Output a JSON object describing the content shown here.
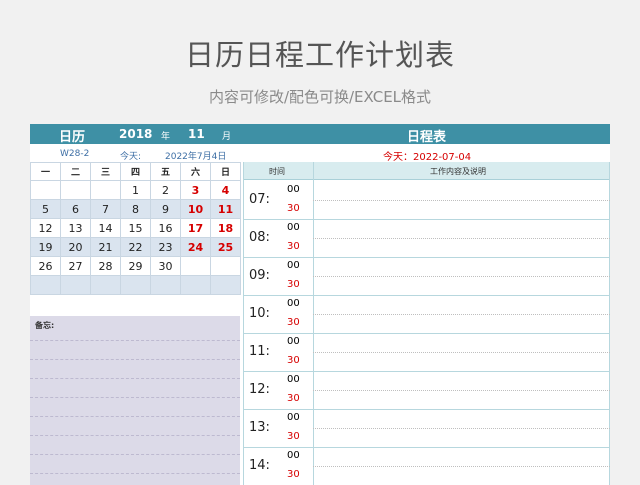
{
  "page": {
    "title": "日历日程工作计划表",
    "subtitle": "内容可修改/配色可换/EXCEL格式"
  },
  "header": {
    "calendar_label": "日历",
    "year": "2018",
    "year_unit": "年",
    "month": "11",
    "month_unit": "月",
    "schedule_label": "日程表"
  },
  "info": {
    "week": "W28-2",
    "today_label": "今天:",
    "today_date": "2022年7月4日",
    "today_iso": "今天：2022-07-04"
  },
  "calendar": {
    "weekdays": [
      "一",
      "二",
      "三",
      "四",
      "五",
      "六",
      "日"
    ],
    "weeks": [
      [
        "",
        "",
        "",
        "1",
        "2",
        "3",
        "4"
      ],
      [
        "5",
        "6",
        "7",
        "8",
        "9",
        "10",
        "11"
      ],
      [
        "12",
        "13",
        "14",
        "15",
        "16",
        "17",
        "18"
      ],
      [
        "19",
        "20",
        "21",
        "22",
        "23",
        "24",
        "25"
      ],
      [
        "26",
        "27",
        "28",
        "29",
        "30",
        "",
        ""
      ],
      [
        "",
        "",
        "",
        "",
        "",
        "",
        ""
      ]
    ]
  },
  "memo": {
    "label": "备忘:"
  },
  "schedule": {
    "time_header": "时间",
    "content_header": "工作内容及说明",
    "hours": [
      "07:",
      "08:",
      "09:",
      "10:",
      "11:",
      "12:",
      "13:",
      "14:"
    ],
    "minute_top": "00",
    "minute_bottom": "30"
  },
  "colors": {
    "accent": "#3e90a5",
    "weekend": "#d60000",
    "memo_bg": "#dcdae8",
    "row_blue": "#dae4ef"
  }
}
